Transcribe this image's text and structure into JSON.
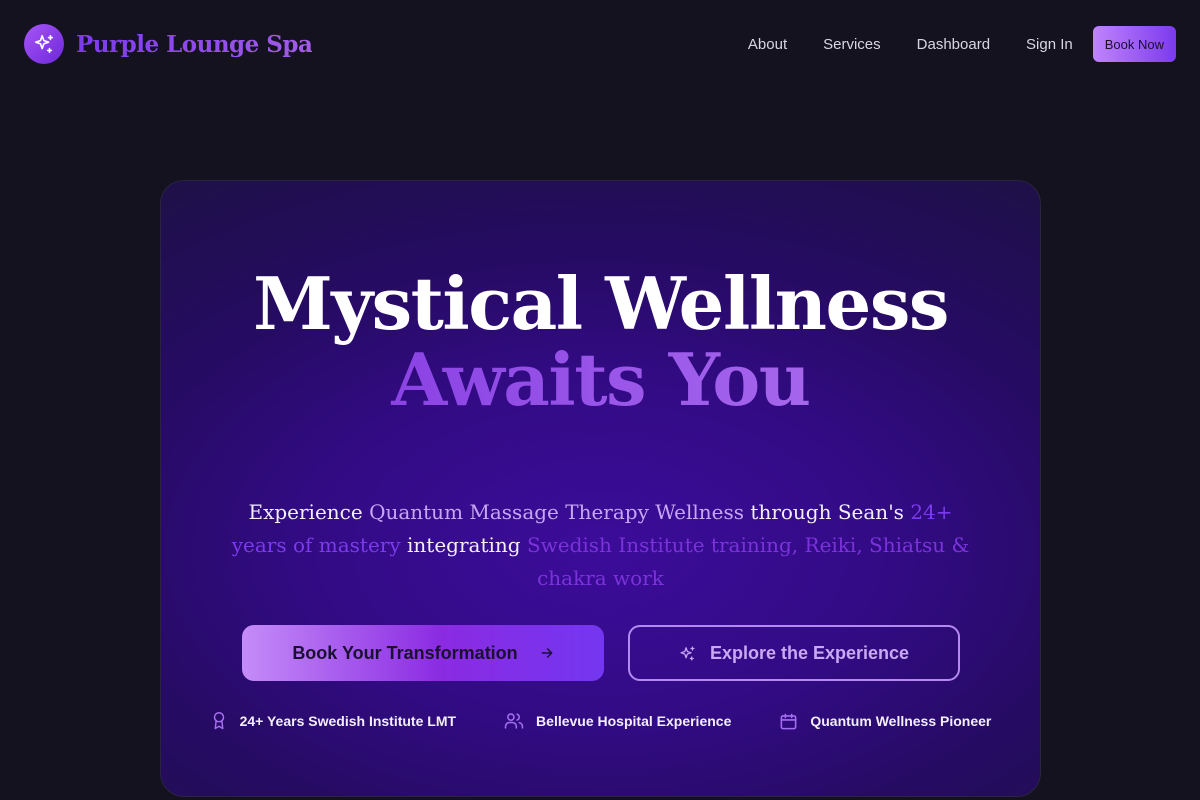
{
  "header": {
    "brand_name": "Purple Lounge Spa",
    "logo_icon": "sparkles-icon",
    "nav": [
      {
        "label": "About"
      },
      {
        "label": "Services"
      },
      {
        "label": "Dashboard"
      },
      {
        "label": "Sign In"
      }
    ],
    "book_now_label": "Book Now"
  },
  "hero": {
    "title_line_1": "Mystical Wellness",
    "title_line_2": "Awaits You",
    "subtitle": {
      "p1": "Experience ",
      "p2": "Quantum Massage Therapy Wellness",
      "p3": " through Sean's ",
      "p4": "24+ years of mastery",
      "p5": " integrating ",
      "p6": "Swedish Institute training, Reiki, Shiatsu & chakra work"
    },
    "primary_cta": {
      "label": "Book Your Transformation",
      "icon": "arrow-right-icon"
    },
    "secondary_cta": {
      "label": "Explore the Experience",
      "icon": "sparkles-icon"
    },
    "badges": [
      {
        "label": "24+ Years Swedish Institute LMT",
        "icon": "award-icon"
      },
      {
        "label": "Bellevue Hospital Experience",
        "icon": "users-icon"
      },
      {
        "label": "Quantum Wellness Pioneer",
        "icon": "calendar-icon"
      }
    ]
  },
  "colors": {
    "background": "#14121f",
    "accent": "#7c3aed",
    "accent_light": "#c084fc",
    "hero_center": "#3c0c9a"
  }
}
